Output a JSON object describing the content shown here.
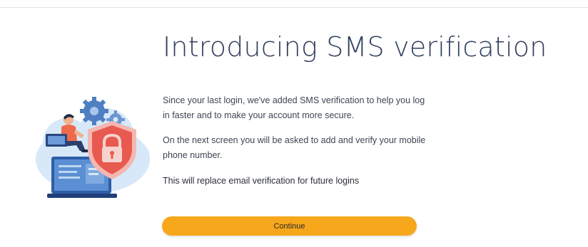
{
  "page": {
    "title": "Introducing SMS verification"
  },
  "message": {
    "paragraph_1": "Since your last login, we've added SMS verification to help you log in faster and to make your account more secure.",
    "paragraph_2": "On the next screen you will be asked to add and verify your mobile phone number.",
    "note": "This will replace email verification for future logins"
  },
  "actions": {
    "continue_label": "Continue"
  },
  "illustration": {
    "icons": [
      "gear-icon",
      "shield-lock-icon",
      "laptop-icon",
      "cloud-icon",
      "person-icon"
    ]
  },
  "colors": {
    "accent": "#f6a71c",
    "title": "#2f3f5d",
    "shield": "#ea5a4f",
    "cloud": "#cfe3f6",
    "laptop": "#3c72bd",
    "gear": "#4f7fc2"
  }
}
